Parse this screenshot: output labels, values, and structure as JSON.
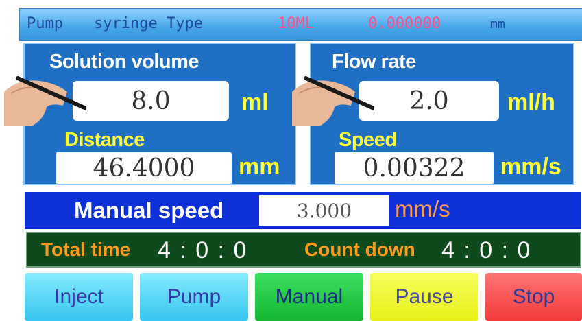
{
  "header": {
    "pump_label": "Pump",
    "syringe_type_label": "syringe Type",
    "syringe_size": "10ML",
    "position_value": "0.000000",
    "position_unit": "mm",
    "accent_color": "#ff4d8a"
  },
  "left_panel": {
    "volume_label": "Solution volume",
    "volume_value": "8.0",
    "volume_unit": "ml",
    "distance_label": "Distance",
    "distance_value": "46.4000",
    "distance_unit": "mm"
  },
  "right_panel": {
    "flow_label": "Flow rate",
    "flow_value": "2.0",
    "flow_unit": "ml/h",
    "speed_label": "Speed",
    "speed_value": "0.00322",
    "speed_unit": "mm/s"
  },
  "manual": {
    "label": "Manual speed",
    "value": "3.000",
    "unit": "mm/s"
  },
  "timer": {
    "total_label": "Total time",
    "total_value": "4 : 0 : 0",
    "countdown_label": "Count down",
    "countdown_value": "4 : 0 : 0"
  },
  "buttons": {
    "inject": "Inject",
    "pump": "Pump",
    "manual": "Manual",
    "pause": "Pause",
    "stop": "Stop"
  },
  "icons": [
    "hand-stylus-icon"
  ]
}
